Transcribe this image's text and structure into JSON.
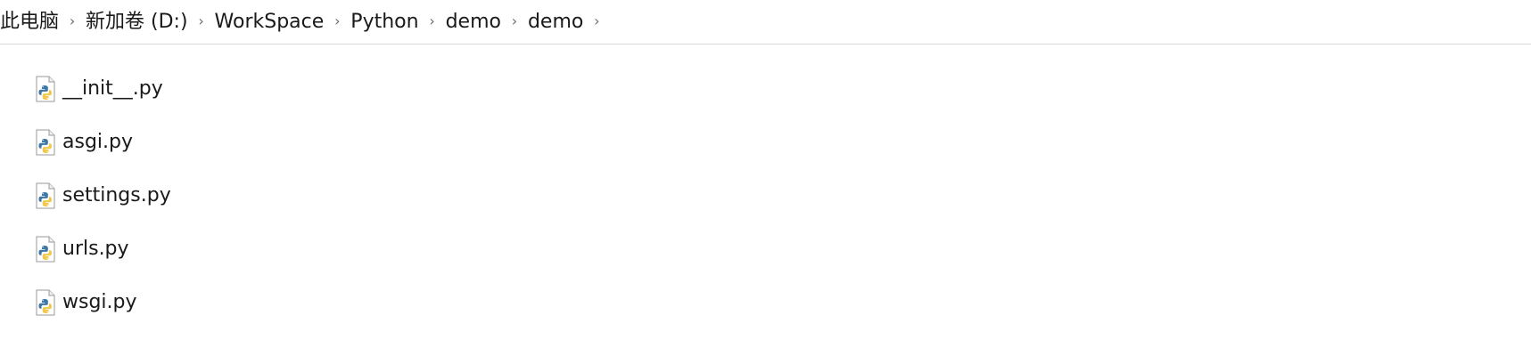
{
  "breadcrumb": {
    "items": [
      {
        "label": "此电脑"
      },
      {
        "label": "新加卷 (D:)"
      },
      {
        "label": "WorkSpace"
      },
      {
        "label": "Python"
      },
      {
        "label": "demo"
      },
      {
        "label": "demo"
      }
    ]
  },
  "files": [
    {
      "name": "__init__.py",
      "icon": "python-file-icon"
    },
    {
      "name": "asgi.py",
      "icon": "python-file-icon"
    },
    {
      "name": "settings.py",
      "icon": "python-file-icon"
    },
    {
      "name": "urls.py",
      "icon": "python-file-icon"
    },
    {
      "name": "wsgi.py",
      "icon": "python-file-icon"
    }
  ],
  "colors": {
    "python_blue": "#3b77a8",
    "python_yellow": "#f2c94c",
    "separator": "#6b6b6b"
  }
}
